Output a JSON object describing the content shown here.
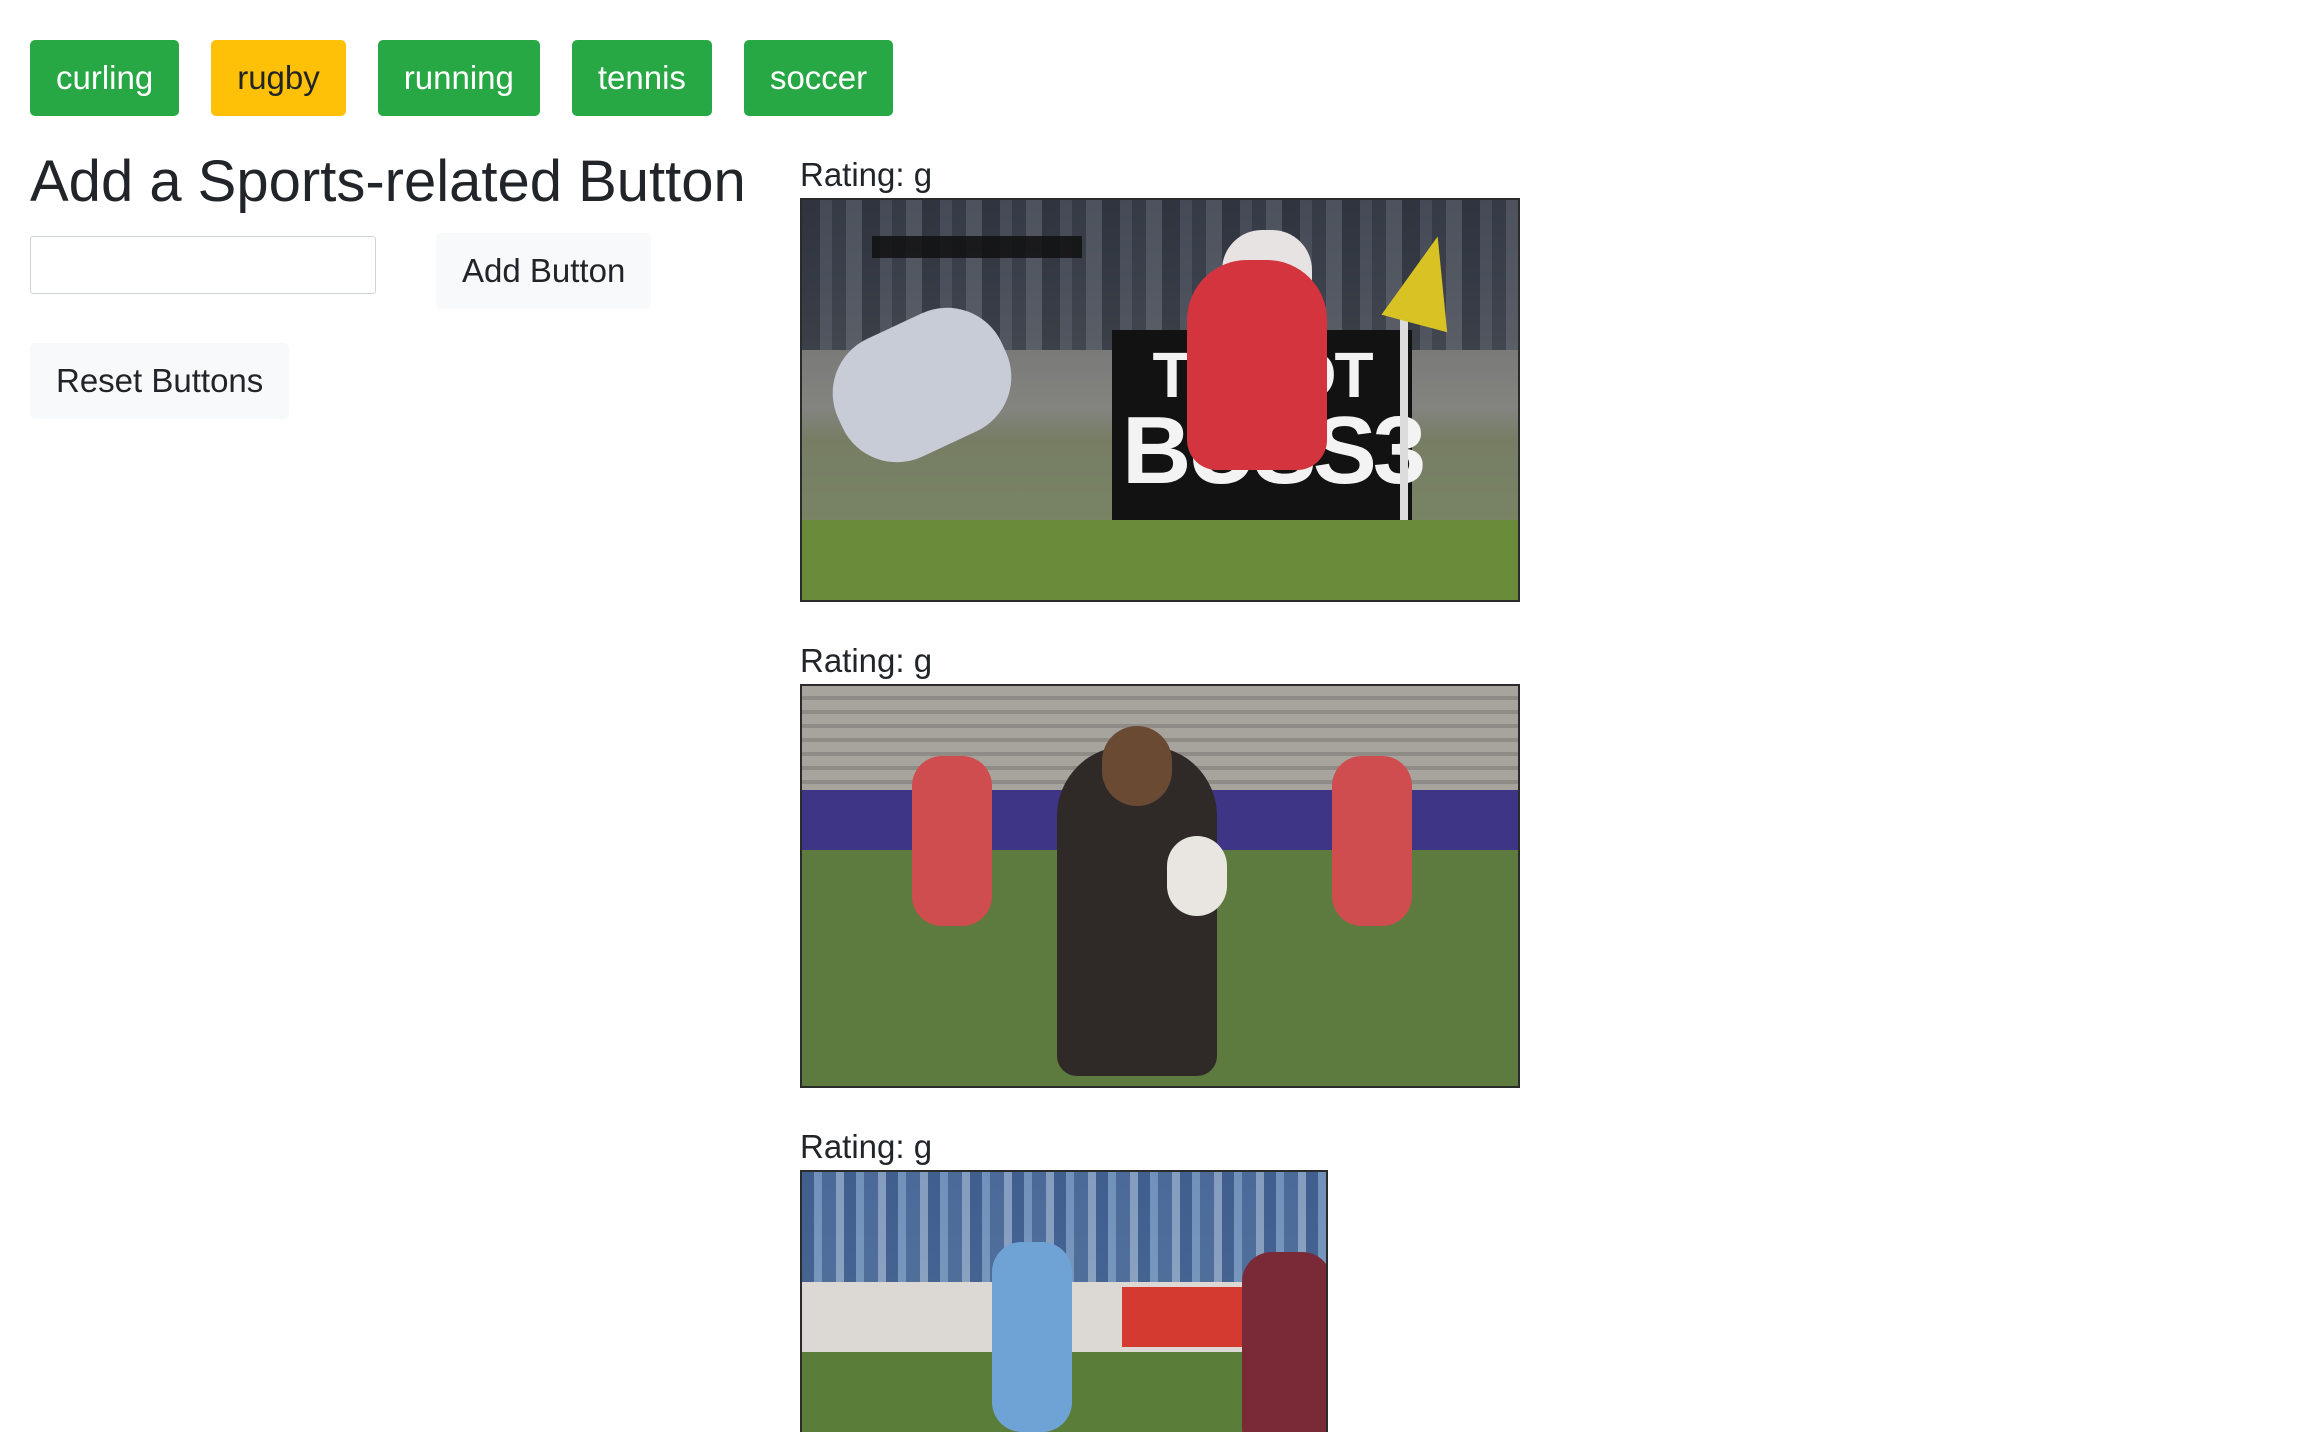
{
  "topics": [
    {
      "label": "curling",
      "state": "success"
    },
    {
      "label": "rugby",
      "state": "warning"
    },
    {
      "label": "running",
      "state": "success"
    },
    {
      "label": "tennis",
      "state": "success"
    },
    {
      "label": "soccer",
      "state": "success"
    }
  ],
  "form": {
    "title": "Add a Sports-related Button",
    "input_value": "",
    "add_label": "Add Button",
    "reset_label": "Reset Buttons"
  },
  "gifs": [
    {
      "rating": "Rating: g",
      "sign_top": "TISSOT",
      "sign_bottom": "BUSS3"
    },
    {
      "rating": "Rating: g"
    },
    {
      "rating": "Rating: g"
    }
  ],
  "colors": {
    "success": "#28a745",
    "warning": "#ffc107",
    "light": "#f8f9fa",
    "text": "#212529"
  }
}
